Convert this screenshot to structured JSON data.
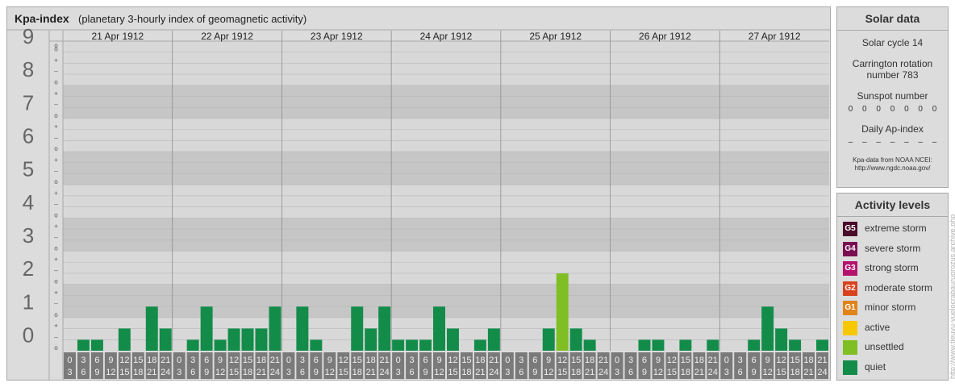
{
  "header": {
    "title": "Kpa-index",
    "subtitle": "(planetary 3-hourly index of geomagnetic activity)"
  },
  "chart_data": {
    "type": "bar",
    "days": [
      "21 Apr 1912",
      "22 Apr 1912",
      "23 Apr 1912",
      "24 Apr 1912",
      "25 Apr 1912",
      "26 Apr 1912",
      "27 Apr 1912"
    ],
    "interval_start_hours": [
      "0",
      "3",
      "6",
      "9",
      "12",
      "15",
      "18",
      "21"
    ],
    "interval_end_hours": [
      "3",
      "6",
      "9",
      "12",
      "15",
      "18",
      "21",
      "24"
    ],
    "y_major_ticks": [
      "0",
      "1",
      "2",
      "3",
      "4",
      "5",
      "6",
      "7",
      "8",
      "9"
    ],
    "y_minor_marks": [
      "–",
      "+",
      "o"
    ],
    "top_mark": "o",
    "ylim": [
      0,
      9.33
    ],
    "series": [
      {
        "values": [
          0,
          0.33,
          0.33,
          0,
          0.67,
          0,
          1.33,
          0.67,
          0,
          0.33,
          1.33,
          0.33,
          0.67,
          0.67,
          0.67,
          1.33,
          0,
          1.33,
          0.33,
          0,
          0,
          1.33,
          0.67,
          1.33,
          0.33,
          0.33,
          0.33,
          1.33,
          0.67,
          0,
          0.33,
          0.67,
          0,
          0,
          0,
          0.67,
          2.33,
          0.67,
          0.33,
          0,
          0,
          0,
          0.33,
          0.33,
          0,
          0.33,
          0,
          0.33,
          0,
          0,
          0.33,
          1.33,
          0.67,
          0.33,
          0,
          0.33
        ]
      }
    ],
    "colors": {
      "quiet": "#138c4a",
      "unsettled": "#7fbf24",
      "tick_box": "#7a7a7a"
    }
  },
  "solar": {
    "title": "Solar data",
    "cycle_label": "Solar cycle 14",
    "carrington_line1": "Carrington rotation",
    "carrington_line2": "number 783",
    "sunspot_title": "Sunspot number",
    "sunspot_values": [
      "0",
      "0",
      "0",
      "0",
      "0",
      "0",
      "0"
    ],
    "ap_title": "Daily Ap-index",
    "ap_values": [
      "–",
      "–",
      "–",
      "–",
      "–",
      "–",
      "–"
    ],
    "source_line1": "Kpa-data from NOAA NCEI:",
    "source_line2": "http://www.ngdc.noaa.gov/"
  },
  "levels": {
    "title": "Activity levels",
    "items": [
      {
        "code": "G5",
        "label": "extreme storm",
        "color": "#4a0d29"
      },
      {
        "code": "G4",
        "label": "severe storm",
        "color": "#7a0e52"
      },
      {
        "code": "G3",
        "label": "strong storm",
        "color": "#b5126e"
      },
      {
        "code": "G2",
        "label": "moderate storm",
        "color": "#d9421e"
      },
      {
        "code": "G1",
        "label": "minor storm",
        "color": "#e0841a"
      },
      {
        "code": "",
        "label": "active",
        "color": "#f7c800"
      },
      {
        "code": "",
        "label": "unsettled",
        "color": "#7fbf24"
      },
      {
        "code": "",
        "label": "quiet",
        "color": "#138c4a"
      }
    ]
  },
  "watermark": "http://www.tieuvu-vuelocrabaurugrozus.archive.php"
}
